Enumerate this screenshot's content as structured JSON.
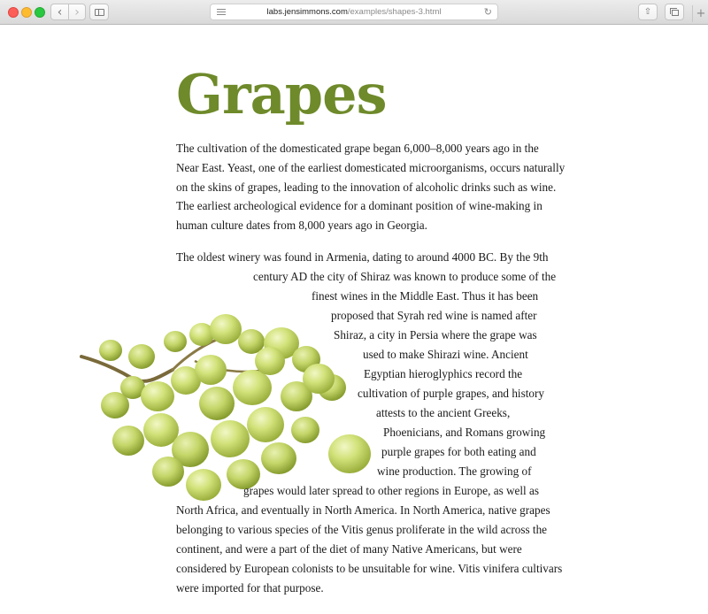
{
  "browser": {
    "url_host": "labs.jensimmons.com",
    "url_path": "/examples/shapes-3.html",
    "back_glyph": "‹",
    "forward_glyph": "›",
    "share_glyph": "⇧",
    "reload_glyph": "↻",
    "newtab_glyph": "+",
    "icons": [
      "back-icon",
      "forward-icon",
      "sidebar-icon",
      "reader-icon",
      "reload-icon",
      "share-icon",
      "tabs-icon",
      "plus-icon"
    ]
  },
  "page": {
    "title": "Grapes",
    "title_color": "#6e8a2a",
    "paragraph1_lines": [
      "The cultivation of the domesticated grape began 6,000–8,000 years ago in the",
      "Near East. Yeast, one of the earliest domesticated microorganisms, occurs naturally",
      "on the skins of grapes, leading to the innovation of alcoholic drinks such as wine.",
      "The earliest archeological evidence for a dominant position of wine-making in",
      "human culture dates from 8,000 years ago in Georgia."
    ],
    "paragraph2_lines": [
      "The oldest winery was found in Armenia, dating to around 4000 BC. By the 9th",
      "century AD the city of Shiraz was known to produce some of the",
      "finest wines in the Middle East. Thus it has been",
      "proposed that Syrah red wine is named after",
      "Shiraz, a city in Persia where the grape was",
      "used to make Shirazi wine. Ancient",
      "Egyptian hieroglyphics record the",
      "cultivation of purple grapes, and history",
      "attests to the ancient Greeks,",
      "Phoenicians, and Romans growing",
      "purple grapes for both eating and",
      "wine production. The growing of",
      "grapes would later spread to other regions in Europe, as well as",
      "North Africa, and eventually in North America. In North America, native grapes",
      "belonging to various species of the Vitis genus proliferate in the wild across the",
      "continent, and were a part of the diet of many Native Americans, but were",
      "considered by European colonists to be unsuitable for wine. Vitis vinifera cultivars",
      "were imported for that purpose."
    ]
  }
}
